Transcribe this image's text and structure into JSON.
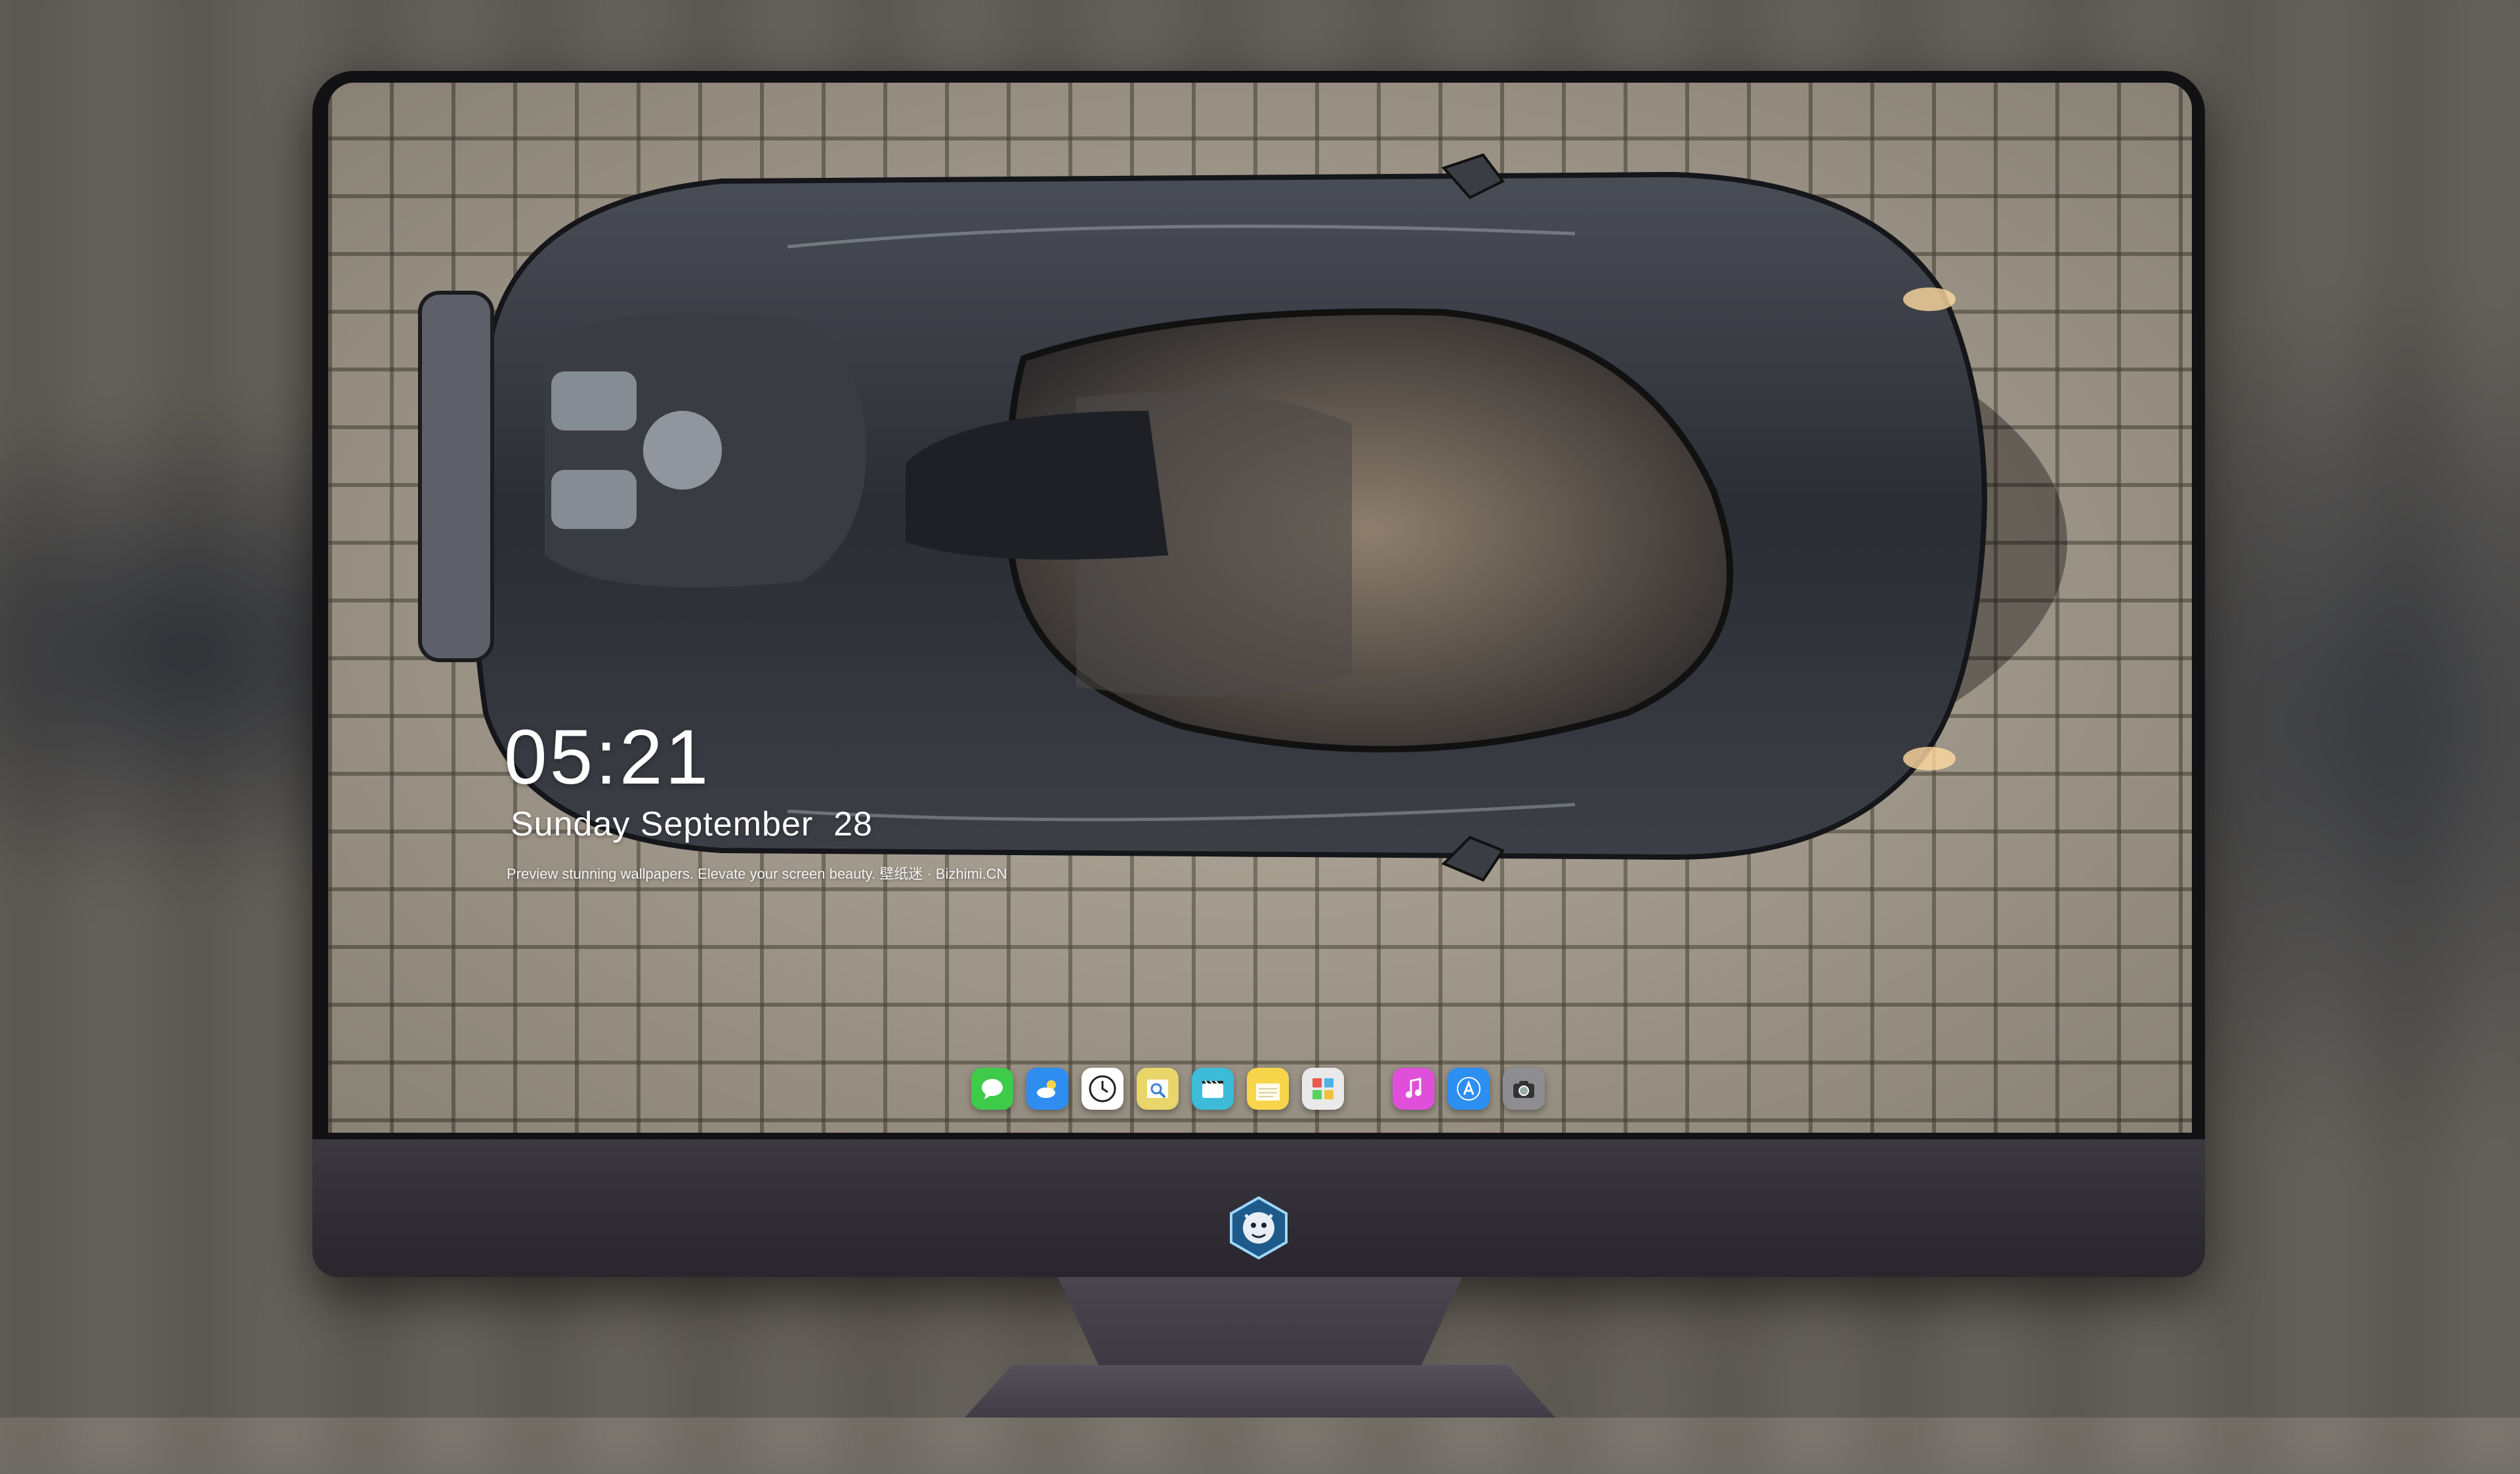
{
  "lockscreen": {
    "time": "05:21",
    "date_weekday_month": "Sunday September",
    "date_day": "28",
    "tagline": "Preview stunning wallpapers. Elevate your screen beauty. 壁纸迷 · Bizhimi.CN"
  },
  "dock": {
    "apps": [
      {
        "icon": "messages-icon",
        "color": "#3ecb4a"
      },
      {
        "icon": "weather-icon",
        "color": "#2f8df0"
      },
      {
        "icon": "clock-icon",
        "color": "#ffffff"
      },
      {
        "icon": "preview-icon",
        "color": "#e9d56a"
      },
      {
        "icon": "video-icon",
        "color": "#3cbcd8"
      },
      {
        "icon": "notes-icon",
        "color": "#f7d54a"
      },
      {
        "icon": "photos-icon",
        "color": "#e9e9ea"
      },
      {
        "icon": "music-icon",
        "color": "#e04fd9"
      },
      {
        "icon": "app-store-icon",
        "color": "#2d8ff2"
      },
      {
        "icon": "camera-icon",
        "color": "#8e8e92"
      }
    ]
  },
  "colors": {
    "monitor_bezel": "#121214",
    "monitor_chin": "#37333c",
    "car_body": "#2a2c33"
  }
}
